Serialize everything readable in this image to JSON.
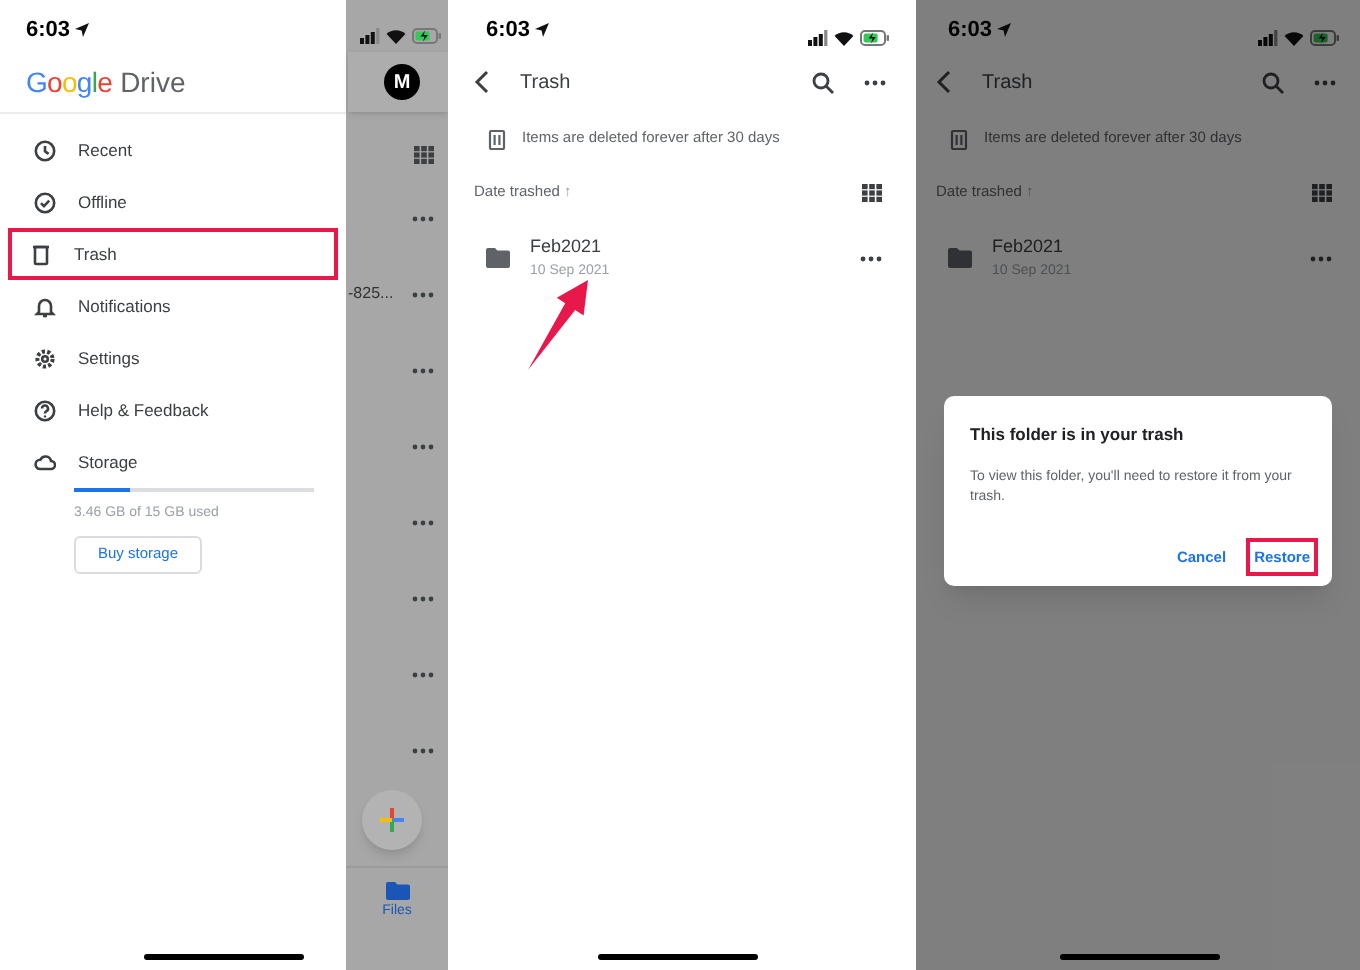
{
  "panels": [
    {
      "kind": "drawer",
      "status_bar": {
        "time": "6:03"
      },
      "logo": {
        "brand": "Google",
        "product": "Drive"
      },
      "menu": [
        {
          "label": "Recent",
          "highlighted": false
        },
        {
          "label": "Offline",
          "highlighted": false
        },
        {
          "label": "Trash",
          "highlighted": true
        },
        {
          "label": "Notifications",
          "highlighted": false
        },
        {
          "label": "Settings",
          "highlighted": false
        },
        {
          "label": "Help & Feedback",
          "highlighted": false
        },
        {
          "label": "Storage",
          "highlighted": false
        }
      ],
      "storage": {
        "level": 0.23,
        "usage": "3.46 GB of 15 GB used",
        "button": "Buy storage"
      },
      "behind": {
        "avatar": "M",
        "rows": [
          {
            "kind": "plain"
          },
          {
            "kind": "snippet",
            "text": "-825..."
          },
          {
            "kind": "plain"
          },
          {
            "kind": "plain"
          },
          {
            "kind": "plain"
          },
          {
            "kind": "plain"
          },
          {
            "kind": "plain"
          },
          {
            "kind": "plain"
          }
        ],
        "bottom_tab": "Files"
      }
    },
    {
      "kind": "trash",
      "status_bar": {
        "time": "6:03"
      },
      "title": "Trash",
      "notice": "Items are deleted forever after 30 days",
      "sort_label": "Date trashed",
      "sort_arrow": "↑",
      "items": [
        {
          "name": "Feb2021",
          "date": "10 Sep 2021"
        }
      ],
      "annotation_arrow": true
    },
    {
      "kind": "trash",
      "status_bar": {
        "time": "6:03"
      },
      "title": "Trash",
      "notice": "Items are deleted forever after 30 days",
      "sort_label": "Date trashed",
      "sort_arrow": "↑",
      "items": [
        {
          "name": "Feb2021",
          "date": "10 Sep 2021"
        }
      ],
      "dialog": {
        "title": "This folder is in your trash",
        "message": "To view this folder, you'll need to restore it from your trash.",
        "buttons": [
          {
            "label": "Cancel",
            "highlighted": false
          },
          {
            "label": "Restore",
            "highlighted": true
          }
        ]
      }
    }
  ]
}
